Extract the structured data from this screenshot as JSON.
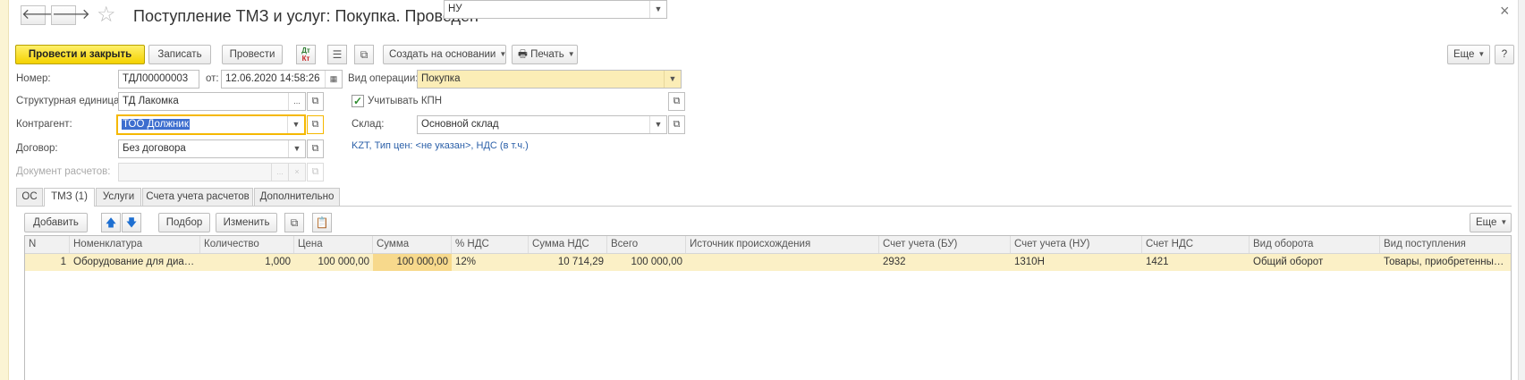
{
  "header": {
    "title": "Поступление ТМЗ и услуг: Покупка. Проведен",
    "back_glyph": "🡐",
    "forward_glyph": "🡒",
    "favorite_glyph": "☆"
  },
  "toolbar": {
    "post_close": "Провести и закрыть",
    "save": "Записать",
    "post": "Провести",
    "dt_kt_top": "Дт",
    "dt_kt_bottom": "Кт",
    "create_based": "Создать на основании",
    "print": "Печать",
    "more": "Еще"
  },
  "form": {
    "number_label": "Номер:",
    "number_value": "ТДЛ00000003",
    "date_label": "от:",
    "date_value": "12.06.2020 14:58:26",
    "operation_label": "Вид операции:",
    "operation_value": "Покупка",
    "unit_label": "Структурная единица:",
    "unit_value": "ТД Лакомка",
    "kpn_label": "Учитывать КПН",
    "kpn_checked": true,
    "kpn_value": "НУ",
    "counterparty_label": "Контрагент:",
    "counterparty_value": "ТОО Должник",
    "warehouse_label": "Склад:",
    "warehouse_value": "Основной склад",
    "contract_label": "Договор:",
    "contract_value": "Без договора",
    "price_link": "KZT, Тип цен: <не указан>, НДС (в т.ч.)",
    "settlement_label": "Документ расчетов:",
    "settlement_value": ""
  },
  "tabs": [
    {
      "label": "ОС",
      "active": false
    },
    {
      "label": "ТМЗ (1)",
      "active": true
    },
    {
      "label": "Услуги",
      "active": false
    },
    {
      "label": "Счета учета расчетов",
      "active": false
    },
    {
      "label": "Дополнительно",
      "active": false
    }
  ],
  "table_toolbar": {
    "add": "Добавить",
    "pick": "Подбор",
    "change": "Изменить",
    "more": "Еще"
  },
  "table": {
    "columns": [
      "N",
      "Номенклатура",
      "Количество",
      "Цена",
      "Сумма",
      "% НДС",
      "Сумма НДС",
      "Всего",
      "Источник происхождения",
      "Счет учета (БУ)",
      "Счет учета (НУ)",
      "Счет НДС",
      "Вид оборота",
      "Вид поступления"
    ],
    "rows": [
      [
        "1",
        "Оборудование для диагн...",
        "1,000",
        "100 000,00",
        "100 000,00",
        "12%",
        "10 714,29",
        "100 000,00",
        "",
        "2932",
        "1310Н",
        "1421",
        "Общий оборот",
        "Товары, приобретенные ..."
      ]
    ]
  },
  "colors": {
    "primary_button": "#f4d200",
    "selected_row": "#fbf0c6",
    "focus_border": "#f5b800",
    "link": "#2a5fa8"
  }
}
